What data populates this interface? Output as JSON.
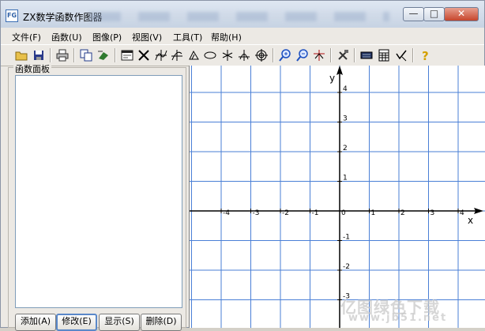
{
  "window": {
    "title": "ZX数学函数作图器",
    "app_icon_text": "FG",
    "controls": {
      "minimize": "—",
      "maximize": "□",
      "close": "✕"
    }
  },
  "menu": [
    {
      "label": "文件(F)"
    },
    {
      "label": "函数(U)"
    },
    {
      "label": "图像(P)"
    },
    {
      "label": "视图(V)"
    },
    {
      "label": "工具(T)"
    },
    {
      "label": "帮助(H)"
    }
  ],
  "toolbar": [
    {
      "icon": "open-folder-icon"
    },
    {
      "icon": "save-disk-icon"
    },
    {
      "icon": "print-icon"
    },
    {
      "icon": "copy-icon"
    },
    {
      "icon": "export-arrow-icon"
    },
    {
      "icon": "function-window-icon"
    },
    {
      "icon": "cross-lines-icon"
    },
    {
      "icon": "curve-icon"
    },
    {
      "icon": "parametric-curve-icon"
    },
    {
      "icon": "triangle-icon"
    },
    {
      "icon": "ellipse-icon"
    },
    {
      "icon": "asterisk-icon"
    },
    {
      "icon": "intersection-icon"
    },
    {
      "icon": "target-icon"
    },
    {
      "icon": "zoom-in-icon"
    },
    {
      "icon": "zoom-out-icon"
    },
    {
      "icon": "axis-move-icon"
    },
    {
      "icon": "tools-icon"
    },
    {
      "icon": "keyboard-icon"
    },
    {
      "icon": "calculator-icon"
    },
    {
      "icon": "checkmark-wand-icon"
    },
    {
      "icon": "help-icon"
    }
  ],
  "panel": {
    "title": "函数面板",
    "buttons": [
      {
        "label": "添加(A)"
      },
      {
        "label": "修改(E)"
      },
      {
        "label": "显示(S)"
      },
      {
        "label": "删除(D)"
      }
    ]
  },
  "graph": {
    "x_axis_label": "x",
    "y_axis_label": "y",
    "x_ticks": [
      -4,
      -3,
      -2,
      -1,
      0,
      1,
      2,
      3,
      4
    ],
    "y_ticks": [
      4,
      3,
      2,
      1,
      -1,
      -2,
      -3
    ],
    "grid_color": "#4a7fd6",
    "axis_color": "#000000"
  },
  "watermark": {
    "line1": "亿图绿色下载",
    "line2": "www.jb51.net"
  }
}
